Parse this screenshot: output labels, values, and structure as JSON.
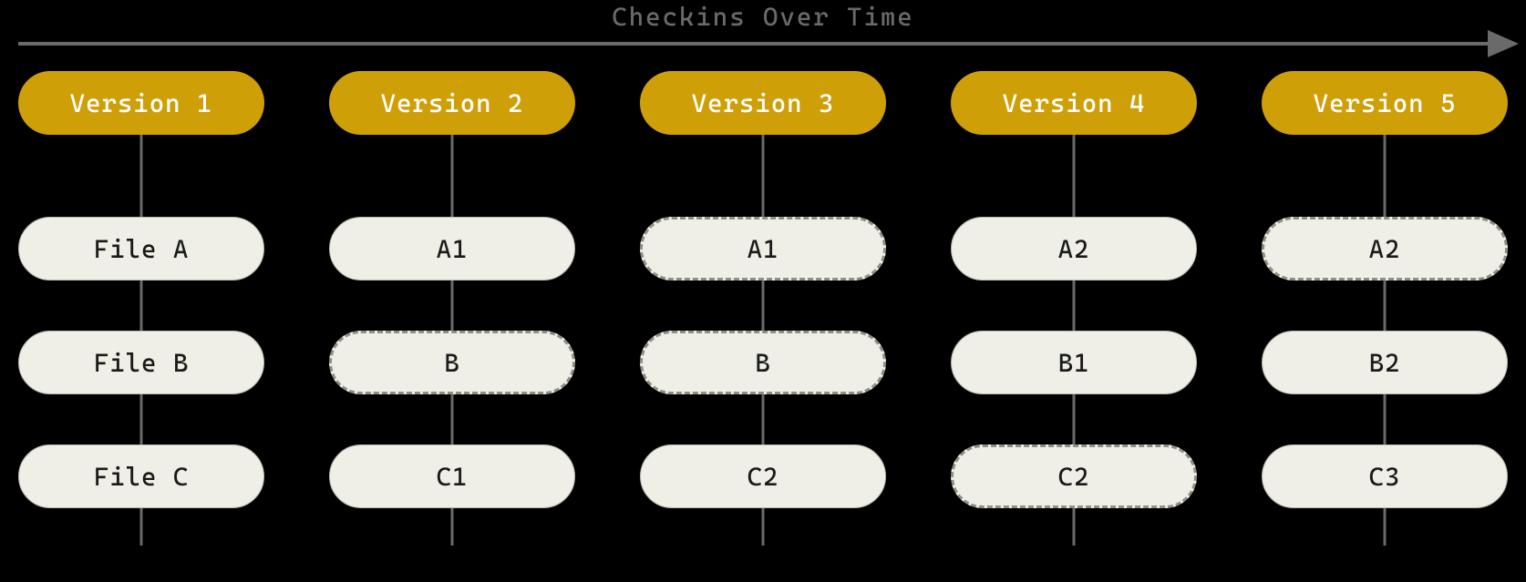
{
  "title": "Checkins Over Time",
  "columns": [
    {
      "header": "Version 1",
      "files": [
        {
          "label": "File A",
          "style": "solid"
        },
        {
          "label": "File B",
          "style": "solid"
        },
        {
          "label": "File C",
          "style": "solid"
        }
      ]
    },
    {
      "header": "Version 2",
      "files": [
        {
          "label": "A1",
          "style": "solid"
        },
        {
          "label": "B",
          "style": "dashed"
        },
        {
          "label": "C1",
          "style": "solid"
        }
      ]
    },
    {
      "header": "Version 3",
      "files": [
        {
          "label": "A1",
          "style": "dashed"
        },
        {
          "label": "B",
          "style": "dashed"
        },
        {
          "label": "C2",
          "style": "solid"
        }
      ]
    },
    {
      "header": "Version 4",
      "files": [
        {
          "label": "A2",
          "style": "solid"
        },
        {
          "label": "B1",
          "style": "solid"
        },
        {
          "label": "C2",
          "style": "dashed"
        }
      ]
    },
    {
      "header": "Version 5",
      "files": [
        {
          "label": "A2",
          "style": "dashed"
        },
        {
          "label": "B2",
          "style": "solid"
        },
        {
          "label": "C3",
          "style": "solid"
        }
      ]
    }
  ]
}
